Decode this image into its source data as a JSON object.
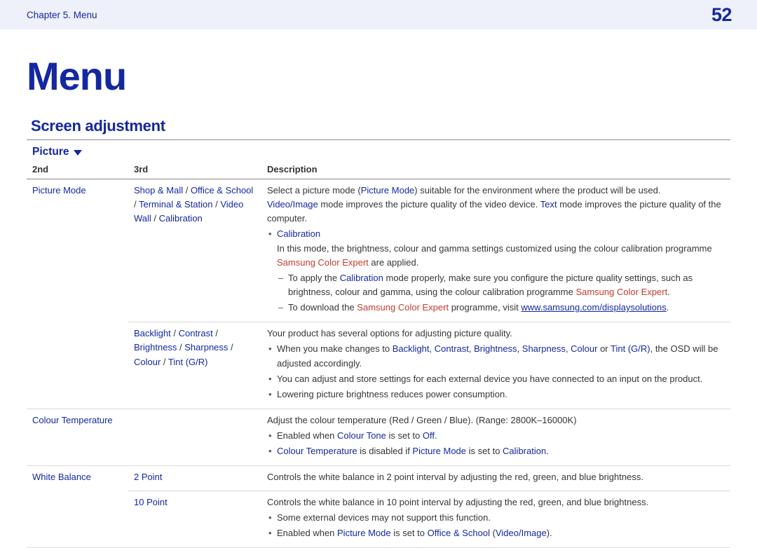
{
  "header": {
    "chapter": "Chapter 5. Menu",
    "page": "52"
  },
  "title": "Menu",
  "section": "Screen adjustment",
  "subsection": "Picture",
  "columns": {
    "c1": "2nd",
    "c2": "3rd",
    "c3": "Description"
  },
  "row1": {
    "c1": "Picture Mode",
    "c2": {
      "a": "Shop & Mall",
      "b": "Office & School",
      "c": "Terminal & Station",
      "d": "Video Wall",
      "e": "Calibration",
      "sep": " / "
    },
    "desc": {
      "l1a": "Select a picture mode (",
      "l1b": "Picture Mode",
      "l1c": ") suitable for the environment where the product will be used.",
      "l2a": "Video/Image",
      "l2b": " mode improves the picture quality of the video device. ",
      "l2c": "Text",
      "l2d": " mode improves the picture quality of the computer.",
      "cal": "Calibration",
      "calp1": "In this mode, the brightness, colour and gamma settings customized using the colour calibration programme ",
      "calp2": "Samsung Color Expert",
      "calp3": " are applied.",
      "d1a": "To apply the ",
      "d1b": "Calibration",
      "d1c": " mode properly, make sure you configure the picture quality settings, such as brightness, colour and gamma, using the colour calibration programme ",
      "d1d": "Samsung Color Expert",
      "d1e": ".",
      "d2a": "To download the ",
      "d2b": "Samsung Color Expert",
      "d2c": " programme, visit ",
      "d2d": "www.samsung.com/displaysolutions",
      "d2e": "."
    }
  },
  "row2": {
    "c2": {
      "a": "Backlight",
      "b": "Contrast",
      "c": "Brightness",
      "d": "Sharpness",
      "e": "Colour",
      "f": "Tint (G/R)",
      "sep": " / "
    },
    "desc": {
      "l1": "Your product has several options for adjusting picture quality.",
      "b1a": "When you make changes to ",
      "b1_backlight": "Backlight",
      "b1_s1": ", ",
      "b1_contrast": "Contrast",
      "b1_s2": ", ",
      "b1_brightness": "Brightness",
      "b1_s3": ", ",
      "b1_sharpness": "Sharpness",
      "b1_s4": ", ",
      "b1_colour": "Colour",
      "b1_s5": " or ",
      "b1_tint": "Tint (G/R)",
      "b1b": ", the OSD will be adjusted accordingly.",
      "b2": "You can adjust and store settings for each external device you have connected to an input on the product.",
      "b3": "Lowering picture brightness reduces power consumption."
    }
  },
  "row3": {
    "c1": "Colour Temperature",
    "desc": {
      "l1": "Adjust the colour temperature (Red / Green / Blue). (Range: 2800K–16000K)",
      "b1a": "Enabled when ",
      "b1b": "Colour Tone",
      "b1c": " is set to ",
      "b1d": "Off",
      "b1e": ".",
      "b2a": "Colour Temperature",
      "b2b": " is disabled if ",
      "b2c": "Picture Mode",
      "b2d": " is set to ",
      "b2e": "Calibration",
      "b2f": "."
    }
  },
  "row4": {
    "c1": "White Balance",
    "c2": "2 Point",
    "desc": "Controls the white balance in 2 point interval by adjusting the red, green, and blue brightness."
  },
  "row5": {
    "c2": "10 Point",
    "desc": {
      "l1": "Controls the white balance in 10 point interval by adjusting the red, green, and blue brightness.",
      "b1": "Some external devices may not support this function.",
      "b2a": "Enabled when ",
      "b2b": "Picture Mode",
      "b2c": " is set to ",
      "b2d": "Office & School",
      "b2e": " (",
      "b2f": "Video/Image",
      "b2g": ")."
    }
  }
}
